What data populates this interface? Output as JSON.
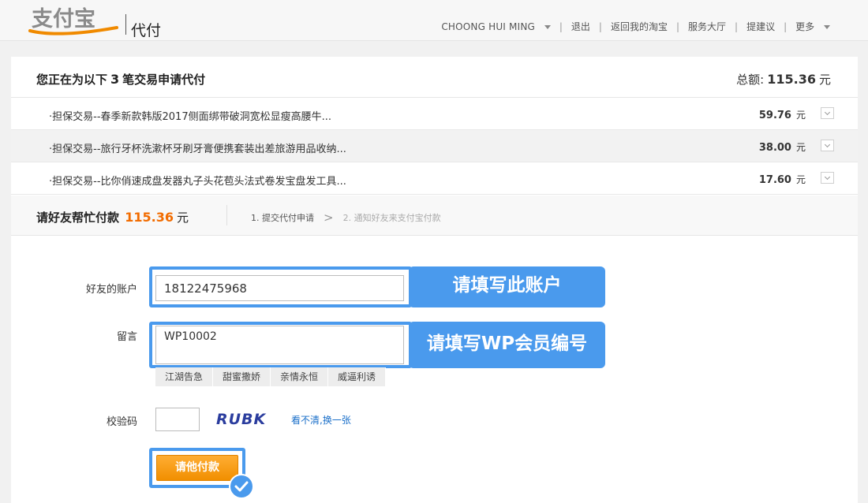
{
  "header": {
    "logo_text": "支付宝",
    "product": "代付",
    "nav": {
      "user": "CHOONG HUI MING",
      "logout": "退出",
      "back_taobao": "返回我的淘宝",
      "service_hall": "服务大厅",
      "suggestion": "提建议",
      "more": "更多"
    }
  },
  "summary": {
    "title_prefix": "您正在为以下",
    "count": "3",
    "title_suffix": "笔交易申请代付",
    "total_label": "总额:",
    "total_amount": "115.36",
    "total_unit": "元"
  },
  "transactions": [
    {
      "name": "·担保交易--春季新款韩版2017侧面绑带破洞宽松显瘦高腰牛...",
      "price": "59.76",
      "unit": "元"
    },
    {
      "name": "·担保交易--旅行牙杯洗漱杯牙刷牙膏便携套装出差旅游用品收纳...",
      "price": "38.00",
      "unit": "元"
    },
    {
      "name": "·担保交易--比你俏速成盘发器丸子头花苞头法式卷发宝盘发工具...",
      "price": "17.60",
      "unit": "元"
    }
  ],
  "pay": {
    "title": "请好友帮忙付款",
    "amount": "115.36",
    "unit": "元",
    "step1": "1. 提交代付申请",
    "step_sep": ">",
    "step2": "2. 通知好友来支付宝付款"
  },
  "form": {
    "account_label": "好友的账户",
    "account_value": "18122475968",
    "account_callout": "请填写此账户",
    "message_label": "留言",
    "message_value": "WP10002",
    "message_callout": "请填写WP会员编号",
    "quick_messages": [
      "江湖告急",
      "甜蜜撒娇",
      "亲情永恒",
      "威逼利诱"
    ],
    "captcha_label": "校验码",
    "captcha_text": "RUBK",
    "captcha_refresh": "看不清,换一张",
    "submit_label": "请他付款"
  },
  "colors": {
    "accent_blue": "#4a9aed",
    "orange_amount": "#f26c00",
    "button_orange": "#f39200",
    "link_blue": "#1a6fc9"
  },
  "icons": [
    "caret-down-icon",
    "chevron-down-icon",
    "check-circle-icon"
  ]
}
